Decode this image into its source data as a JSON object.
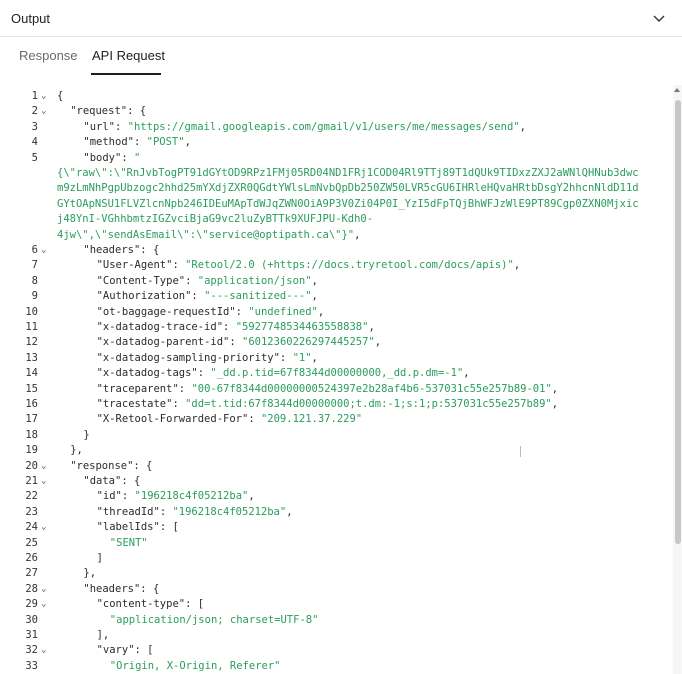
{
  "header": {
    "title": "Output",
    "collapse_icon": "chevron-down-icon"
  },
  "tabs": [
    {
      "label": "Response",
      "active": false
    },
    {
      "label": "API Request",
      "active": true
    }
  ],
  "code_lines": [
    {
      "n": "1",
      "fold": true,
      "indent": 0,
      "parts": [
        [
          "p",
          "{"
        ]
      ]
    },
    {
      "n": "2",
      "fold": true,
      "indent": 1,
      "parts": [
        [
          "k",
          "\"request\""
        ],
        [
          "p",
          ": {"
        ]
      ]
    },
    {
      "n": "3",
      "fold": false,
      "indent": 2,
      "parts": [
        [
          "k",
          "\"url\""
        ],
        [
          "p",
          ": "
        ],
        [
          "s",
          "\"https://gmail.googleapis.com/gmail/v1/users/me/messages/send\""
        ],
        [
          "p",
          ","
        ]
      ]
    },
    {
      "n": "4",
      "fold": false,
      "indent": 2,
      "parts": [
        [
          "k",
          "\"method\""
        ],
        [
          "p",
          ": "
        ],
        [
          "s",
          "\"POST\""
        ],
        [
          "p",
          ","
        ]
      ]
    },
    {
      "n": "5",
      "fold": false,
      "indent": 2,
      "parts": [
        [
          "k",
          "\"body\""
        ],
        [
          "p",
          ": "
        ],
        [
          "s",
          "\""
        ]
      ]
    },
    {
      "n": "",
      "fold": false,
      "indent": 0,
      "parts": [
        [
          "s",
          "{\\\"raw\\\":\\\"RnJvbTogPT91dGYtOD9RPz1FMj05RD04ND1FRj1COD04Rl9TTj89T1dQUk9TIDxzZXJ2aWNlQHNub3dwc"
        ]
      ]
    },
    {
      "n": "",
      "fold": false,
      "indent": 0,
      "parts": [
        [
          "s",
          "m9zLmNhPgpUbzogc2hhd25mYXdjZXR0QGdtYWlsLmNvbQpDb250ZW50LVR5cGU6IHRleHQvaHRtbDsgY2hhcnNldD11d"
        ]
      ]
    },
    {
      "n": "",
      "fold": false,
      "indent": 0,
      "parts": [
        [
          "s",
          "GYtOApNSU1FLVZlcnNpb246IDEuMApTdWJqZWN0OiA9P3V0Zi04P0I_YzI5dFpTQjBhWFJzWlE9PT89Cgp0ZXN0Mjxic"
        ]
      ]
    },
    {
      "n": "",
      "fold": false,
      "indent": 0,
      "parts": [
        [
          "s",
          "j48YnI-VGhhbmtzIGZvciBjaG9vc2luZyBTTk9XUFJPU-Kdh0-"
        ]
      ]
    },
    {
      "n": "",
      "fold": false,
      "indent": 0,
      "parts": [
        [
          "s",
          "4jw\\\",\\\"sendAsEmail\\\":\\\"service@optipath.ca\\\"}\""
        ],
        [
          "p",
          ","
        ]
      ]
    },
    {
      "n": "6",
      "fold": true,
      "indent": 2,
      "parts": [
        [
          "k",
          "\"headers\""
        ],
        [
          "p",
          ": {"
        ]
      ]
    },
    {
      "n": "7",
      "fold": false,
      "indent": 3,
      "parts": [
        [
          "k",
          "\"User-Agent\""
        ],
        [
          "p",
          ": "
        ],
        [
          "s",
          "\"Retool/2.0 (+https://docs.tryretool.com/docs/apis)\""
        ],
        [
          "p",
          ","
        ]
      ]
    },
    {
      "n": "8",
      "fold": false,
      "indent": 3,
      "parts": [
        [
          "k",
          "\"Content-Type\""
        ],
        [
          "p",
          ": "
        ],
        [
          "s",
          "\"application/json\""
        ],
        [
          "p",
          ","
        ]
      ]
    },
    {
      "n": "9",
      "fold": false,
      "indent": 3,
      "parts": [
        [
          "k",
          "\"Authorization\""
        ],
        [
          "p",
          ": "
        ],
        [
          "s",
          "\"---sanitized---\""
        ],
        [
          "p",
          ","
        ]
      ]
    },
    {
      "n": "10",
      "fold": false,
      "indent": 3,
      "parts": [
        [
          "k",
          "\"ot-baggage-requestId\""
        ],
        [
          "p",
          ": "
        ],
        [
          "s",
          "\"undefined\""
        ],
        [
          "p",
          ","
        ]
      ]
    },
    {
      "n": "11",
      "fold": false,
      "indent": 3,
      "parts": [
        [
          "k",
          "\"x-datadog-trace-id\""
        ],
        [
          "p",
          ": "
        ],
        [
          "s",
          "\"5927748534463558838\""
        ],
        [
          "p",
          ","
        ]
      ]
    },
    {
      "n": "12",
      "fold": false,
      "indent": 3,
      "parts": [
        [
          "k",
          "\"x-datadog-parent-id\""
        ],
        [
          "p",
          ": "
        ],
        [
          "s",
          "\"6012360226297445257\""
        ],
        [
          "p",
          ","
        ]
      ]
    },
    {
      "n": "13",
      "fold": false,
      "indent": 3,
      "parts": [
        [
          "k",
          "\"x-datadog-sampling-priority\""
        ],
        [
          "p",
          ": "
        ],
        [
          "s",
          "\"1\""
        ],
        [
          "p",
          ","
        ]
      ]
    },
    {
      "n": "14",
      "fold": false,
      "indent": 3,
      "parts": [
        [
          "k",
          "\"x-datadog-tags\""
        ],
        [
          "p",
          ": "
        ],
        [
          "s",
          "\"_dd.p.tid=67f8344d00000000,_dd.p.dm=-1\""
        ],
        [
          "p",
          ","
        ]
      ]
    },
    {
      "n": "15",
      "fold": false,
      "indent": 3,
      "parts": [
        [
          "k",
          "\"traceparent\""
        ],
        [
          "p",
          ": "
        ],
        [
          "s",
          "\"00-67f8344d00000000524397e2b28af4b6-537031c55e257b89-01\""
        ],
        [
          "p",
          ","
        ]
      ]
    },
    {
      "n": "16",
      "fold": false,
      "indent": 3,
      "parts": [
        [
          "k",
          "\"tracestate\""
        ],
        [
          "p",
          ": "
        ],
        [
          "s",
          "\"dd=t.tid:67f8344d00000000;t.dm:-1;s:1;p:537031c55e257b89\""
        ],
        [
          "p",
          ","
        ]
      ]
    },
    {
      "n": "17",
      "fold": false,
      "indent": 3,
      "parts": [
        [
          "k",
          "\"X-Retool-Forwarded-For\""
        ],
        [
          "p",
          ": "
        ],
        [
          "s",
          "\"209.121.37.229\""
        ]
      ]
    },
    {
      "n": "18",
      "fold": false,
      "indent": 2,
      "parts": [
        [
          "p",
          "}"
        ]
      ]
    },
    {
      "n": "19",
      "fold": false,
      "indent": 1,
      "parts": [
        [
          "p",
          "},"
        ]
      ]
    },
    {
      "n": "20",
      "fold": true,
      "indent": 1,
      "parts": [
        [
          "k",
          "\"response\""
        ],
        [
          "p",
          ": {"
        ]
      ]
    },
    {
      "n": "21",
      "fold": true,
      "indent": 2,
      "parts": [
        [
          "k",
          "\"data\""
        ],
        [
          "p",
          ": {"
        ]
      ]
    },
    {
      "n": "22",
      "fold": false,
      "indent": 3,
      "parts": [
        [
          "k",
          "\"id\""
        ],
        [
          "p",
          ": "
        ],
        [
          "s",
          "\"196218c4f05212ba\""
        ],
        [
          "p",
          ","
        ]
      ]
    },
    {
      "n": "23",
      "fold": false,
      "indent": 3,
      "parts": [
        [
          "k",
          "\"threadId\""
        ],
        [
          "p",
          ": "
        ],
        [
          "s",
          "\"196218c4f05212ba\""
        ],
        [
          "p",
          ","
        ]
      ]
    },
    {
      "n": "24",
      "fold": true,
      "indent": 3,
      "parts": [
        [
          "k",
          "\"labelIds\""
        ],
        [
          "p",
          ": ["
        ]
      ]
    },
    {
      "n": "25",
      "fold": false,
      "indent": 4,
      "parts": [
        [
          "s",
          "\"SENT\""
        ]
      ]
    },
    {
      "n": "26",
      "fold": false,
      "indent": 3,
      "parts": [
        [
          "p",
          "]"
        ]
      ]
    },
    {
      "n": "27",
      "fold": false,
      "indent": 2,
      "parts": [
        [
          "p",
          "},"
        ]
      ]
    },
    {
      "n": "28",
      "fold": true,
      "indent": 2,
      "parts": [
        [
          "k",
          "\"headers\""
        ],
        [
          "p",
          ": {"
        ]
      ]
    },
    {
      "n": "29",
      "fold": true,
      "indent": 3,
      "parts": [
        [
          "k",
          "\"content-type\""
        ],
        [
          "p",
          ": ["
        ]
      ]
    },
    {
      "n": "30",
      "fold": false,
      "indent": 4,
      "parts": [
        [
          "s",
          "\"application/json; charset=UTF-8\""
        ]
      ]
    },
    {
      "n": "31",
      "fold": false,
      "indent": 3,
      "parts": [
        [
          "p",
          "],"
        ]
      ]
    },
    {
      "n": "32",
      "fold": true,
      "indent": 3,
      "parts": [
        [
          "k",
          "\"vary\""
        ],
        [
          "p",
          ": ["
        ]
      ]
    },
    {
      "n": "33",
      "fold": false,
      "indent": 4,
      "parts": [
        [
          "s",
          "\"Origin, X-Origin, Referer\""
        ]
      ]
    }
  ]
}
